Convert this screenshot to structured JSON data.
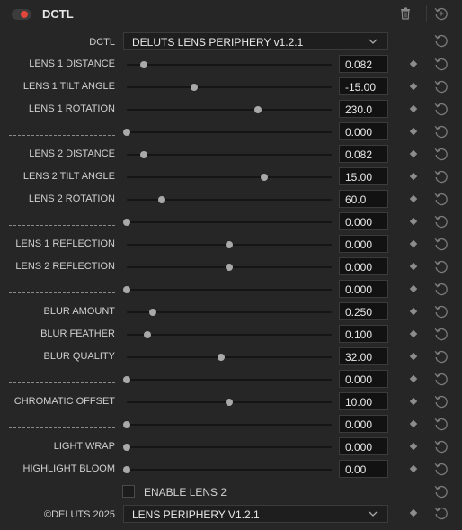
{
  "header": {
    "title": "DCTL",
    "toggle_on": true,
    "accent_color": "#e3463b"
  },
  "dctl": {
    "label": "DCTL",
    "selected": "DELUTS LENS PERIPHERY v1.2.1"
  },
  "params": [
    {
      "label": "LENS 1 DISTANCE",
      "value": "0.082",
      "pos": 0.082
    },
    {
      "label": "LENS 1 TILT ANGLE",
      "value": "-15.00",
      "pos": 0.33
    },
    {
      "label": "LENS 1 ROTATION",
      "value": "230.0",
      "pos": 0.64
    },
    {
      "label": "",
      "value": "0.000",
      "pos": 0.0,
      "divider": true
    },
    {
      "label": "LENS 2 DISTANCE",
      "value": "0.082",
      "pos": 0.082
    },
    {
      "label": "LENS 2 TILT ANGLE",
      "value": "15.00",
      "pos": 0.67
    },
    {
      "label": "LENS 2 ROTATION",
      "value": "60.0",
      "pos": 0.17
    },
    {
      "label": "",
      "value": "0.000",
      "pos": 0.0,
      "divider": true
    },
    {
      "label": "LENS 1 REFLECTION",
      "value": "0.000",
      "pos": 0.5
    },
    {
      "label": "LENS 2 REFLECTION",
      "value": "0.000",
      "pos": 0.5
    },
    {
      "label": "",
      "value": "0.000",
      "pos": 0.0,
      "divider": true
    },
    {
      "label": "BLUR AMOUNT",
      "value": "0.250",
      "pos": 0.125
    },
    {
      "label": "BLUR FEATHER",
      "value": "0.100",
      "pos": 0.1
    },
    {
      "label": "BLUR QUALITY",
      "value": "32.00",
      "pos": 0.46
    },
    {
      "label": "",
      "value": "0.000",
      "pos": 0.0,
      "divider": true
    },
    {
      "label": "CHROMATIC OFFSET",
      "value": "10.00",
      "pos": 0.5
    },
    {
      "label": "",
      "value": "0.000",
      "pos": 0.0,
      "divider": true
    },
    {
      "label": "LIGHT WRAP",
      "value": "0.000",
      "pos": 0.0
    },
    {
      "label": "HIGHLIGHT BLOOM",
      "value": "0.00",
      "pos": 0.0
    }
  ],
  "enable_lens2": {
    "label": "ENABLE LENS 2",
    "checked": false
  },
  "footer": {
    "label": "©DELUTS 2025",
    "selected": "LENS PERIPHERY V1.2.1"
  },
  "icons": {
    "trash": "trash-icon",
    "reset": "reset-icon",
    "keyframe": "keyframe-diamond-icon",
    "chevron": "chevron-down-icon"
  }
}
